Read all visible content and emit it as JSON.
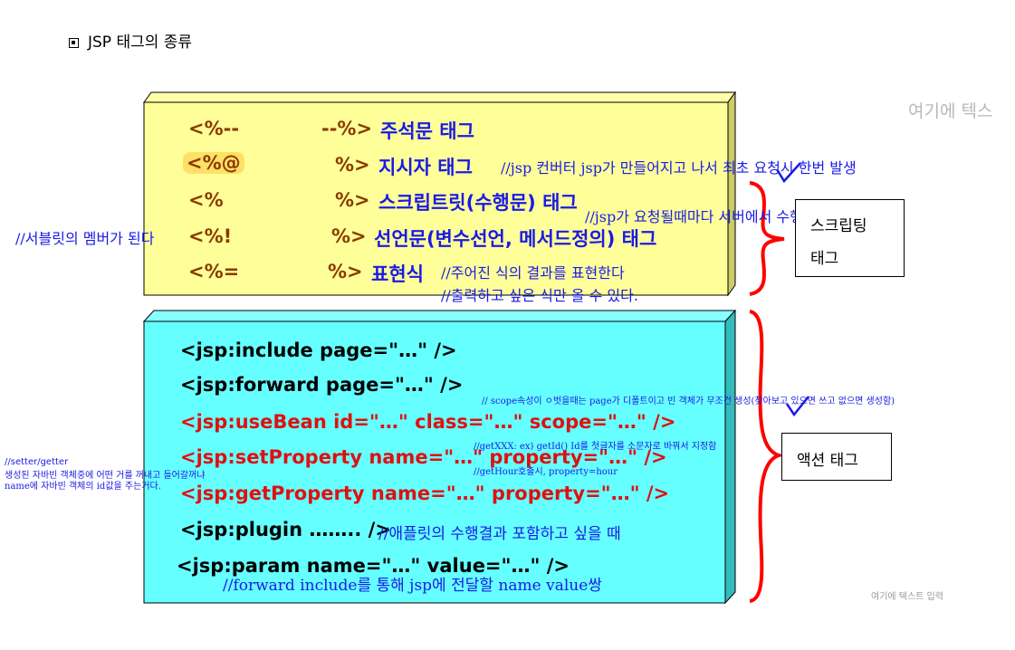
{
  "header": {
    "title": "JSP 태그의 종류"
  },
  "placeholders": {
    "top": "여기에 텍스",
    "bottom": "여기에 텍스트 입력"
  },
  "script_tags": {
    "rows": [
      {
        "open": "<%--",
        "close": "--%>",
        "label": "주석문 태그",
        "note": ""
      },
      {
        "open": "<%@",
        "close": "%>",
        "label": "지시자 태그",
        "note": "//jsp 컨버터 jsp가 만들어지고 나서 최초 요청시 한번 발생"
      },
      {
        "open": "<%",
        "close": "%>",
        "label": "스크립트릿(수행문) 태그",
        "note": "//jsp가  요청될때마다 서버에서 수행할 자유로운 코드"
      },
      {
        "open": "<%!",
        "close": "%>",
        "label": "선언문(변수선언, 메서드정의) 태그",
        "note": "//서블릿의 멤버가 된다"
      },
      {
        "open": "<%=",
        "close": "%>",
        "label": "표현식",
        "note": "//주어진 식의 결과를 표현한다",
        "note2": "//출력하고 싶은 식만 올 수 있다."
      }
    ],
    "side_label_line1": "스크립팅",
    "side_label_line2": "태그"
  },
  "action_tags": {
    "rows": [
      {
        "text": "<jsp:include page=\"…\" />",
        "color": "#000000"
      },
      {
        "text": "<jsp:forward page=\"…\" />",
        "color": "#000000"
      },
      {
        "text": "<jsp:useBean id=\"…\" class=\"…\" scope=\"…\" />",
        "color": "#e01010"
      },
      {
        "text": "<jsp:setProperty name=\"…\" property=\"…\" />",
        "color": "#e01010"
      },
      {
        "text": "<jsp:getProperty name=\"…\" property=\"…\" />",
        "color": "#e01010"
      },
      {
        "text": "<jsp:plugin …….. />",
        "color": "#000000"
      },
      {
        "text": "<jsp:param name=\"…\" value=\"…\" />",
        "color": "#000000"
      }
    ],
    "plugin_note": "//애플릿의 수행결과 포함하고 싶을 때",
    "param_note": "//forward include를 통해 jsp에 전달할 name value쌍",
    "usebean_note": "// scope속성이 ㅇ벗을때는 page가 디폴트이고 빈 객체가 무조건 생성(찾아보고 있으면 쓰고 없으면 생성함)",
    "set_note1": "//getXXX: ex) getId() Id를 첫글자를 소문자로 바꿔서 지정함",
    "set_note2": "//getHour호출시, property=hour",
    "left_note_title": "//setter/getter",
    "left_note_line1": "생성된 자바빈 객체중에 어떤 거를 꺼내고 들어갈꺼냐",
    "left_note_line2": "name에 자바빈 객체의 id값을 주는거다.",
    "side_label": "액션 태그"
  },
  "colors": {
    "yellow_box": "#ffff99",
    "cyan_box": "#66ffff",
    "brace": "#ff0000",
    "note_blue": "#1a1ae6",
    "checkmark": "#1a1ae6"
  }
}
